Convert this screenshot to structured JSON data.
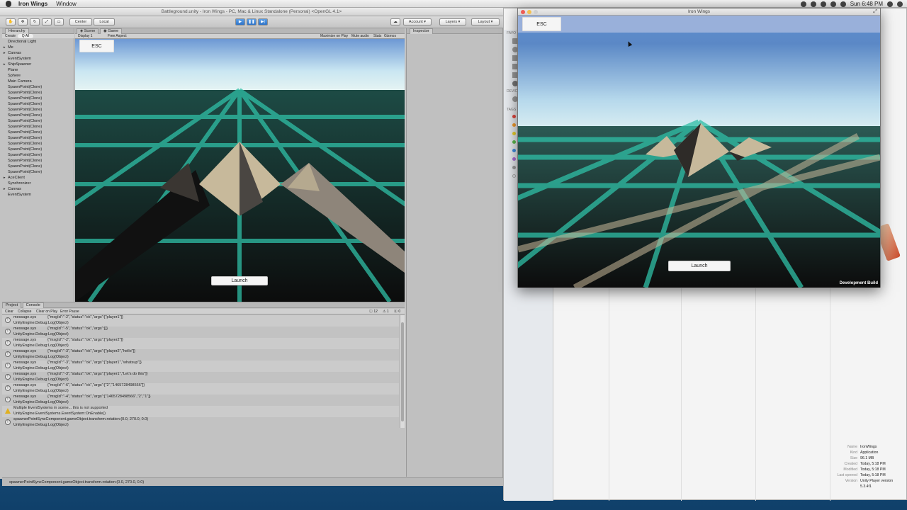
{
  "menubar": {
    "app_name": "Iron Wings",
    "menu_window": "Window",
    "clock": "Sun 6:48 PM"
  },
  "unity": {
    "title": "Battleground.unity - Iron Wings - PC, Mac & Linux Standalone (Personal) <OpenGL 4.1>",
    "toolbar": {
      "center": "Center",
      "local": "Local",
      "account": "Account",
      "layers": "Layers",
      "layout": "Layout"
    },
    "hierarchy": {
      "tab": "Hierarchy",
      "create": "Create",
      "search_placeholder": "Q All",
      "items": [
        "Directional Light",
        "Me",
        "Canvas",
        "EventSystem",
        "ShipSpawner",
        "Plane",
        "Sphere",
        "Main Camera",
        "SpawnPoint(Clone)",
        "SpawnPoint(Clone)",
        "SpawnPoint(Clone)",
        "SpawnPoint(Clone)",
        "SpawnPoint(Clone)",
        "SpawnPoint(Clone)",
        "SpawnPoint(Clone)",
        "SpawnPoint(Clone)",
        "SpawnPoint(Clone)",
        "SpawnPoint(Clone)",
        "SpawnPoint(Clone)",
        "SpawnPoint(Clone)",
        "SpawnPoint(Clone)",
        "SpawnPoint(Clone)",
        "SpawnPoint(Clone)",
        "SpawnPoint(Clone)",
        "AceClient",
        "Synchronizer",
        "Canvas",
        "EventSystem"
      ]
    },
    "game_panel": {
      "tab_scene": "Scene",
      "tab_game": "Game",
      "display": "Display 1",
      "aspect": "Free Aspect",
      "maximize": "Maximize on Play",
      "mute": "Mute audio",
      "stats": "Stats",
      "gizmos": "Gizmos",
      "esc_label": "ESC",
      "launch_label": "Launch"
    },
    "inspector": {
      "tab": "Inspector"
    },
    "console": {
      "tab_project": "Project",
      "tab_console": "Console",
      "clear": "Clear",
      "collapse": "Collapse",
      "clear_on_play": "Clear on Play",
      "error_pause": "Error Pause",
      "count_info": "12",
      "count_warn": "1",
      "count_err": "0",
      "rows": [
        {
          "type": "info",
          "line1_tag": "message.sys",
          "line1": "{\"msgId\":\"-2\",\"status\":\"ok\",\"args\":[\"player1\"]}",
          "line2": "UnityEngine.Debug:Log(Object)"
        },
        {
          "type": "info",
          "line1_tag": "message.sys",
          "line1": "{\"msgId\":\"-5\",\"status\":\"ok\",\"args\":[]}",
          "line2": "UnityEngine.Debug:Log(Object)"
        },
        {
          "type": "info",
          "line1_tag": "message.sys",
          "line1": "{\"msgId\":\"-2\",\"status\":\"ok\",\"args\":[\"player2\"]}",
          "line2": "UnityEngine.Debug:Log(Object)"
        },
        {
          "type": "info",
          "line1_tag": "message.sys",
          "line1": "{\"msgId\":\"-3\",\"status\":\"ok\",\"args\":[\"player2\",\"hello\"]}",
          "line2": "UnityEngine.Debug:Log(Object)"
        },
        {
          "type": "info",
          "line1_tag": "message.sys",
          "line1": "{\"msgId\":\"-3\",\"status\":\"ok\",\"args\":[\"player1\",\"whatsup\"]}",
          "line2": "UnityEngine.Debug:Log(Object)"
        },
        {
          "type": "info",
          "line1_tag": "message.sys",
          "line1": "{\"msgId\":\"-3\",\"status\":\"ok\",\"args\":[\"player1\",\"Let's do this\"]}",
          "line2": "UnityEngine.Debug:Log(Object)"
        },
        {
          "type": "info",
          "line1_tag": "message.sys",
          "line1": "{\"msgId\":\"-6\",\"status\":\"ok\",\"args\":[\"2\",\"1465728498566\"]}",
          "line2": "UnityEngine.Debug:Log(Object)"
        },
        {
          "type": "info",
          "line1_tag": "message.sys",
          "line1": "{\"msgId\":\"-4\",\"status\":\"ok\",\"args\":[\"1465728498566\",\"2\",\"1\"]}",
          "line2": "UnityEngine.Debug:Log(Object)"
        },
        {
          "type": "warn",
          "line1_tag": "",
          "line1": "Multiple EventSystems in scene... this is not supported",
          "line2": "UnityEngine.EventSystems.EventSystem:OnEnable()"
        },
        {
          "type": "info",
          "line1_tag": "",
          "line1": "spawnerPointSyncComponent.gameObject.transform.rotation:(0.0, 270.0, 0.0)",
          "line2": "UnityEngine.Debug:Log(Object)"
        }
      ]
    },
    "status_text": "spawnerPointSyncComponent.gameObject.transform.rotation:(0.0, 270.0, 0.0)"
  },
  "player": {
    "title": "Iron Wings",
    "esc_label": "ESC",
    "launch_label": "Launch",
    "dev_build": "Development Build"
  },
  "finder": {
    "sidebar_labels": [
      "FAVO",
      "DEVIC",
      "TAGS"
    ],
    "info": [
      {
        "k": "Name",
        "v": "IronWings"
      },
      {
        "k": "Kind",
        "v": "Application"
      },
      {
        "k": "Size",
        "v": "96.1 MB"
      },
      {
        "k": "Created",
        "v": "Today, 5:18 PM"
      },
      {
        "k": "Modified",
        "v": "Today, 5:18 PM"
      },
      {
        "k": "Last opened",
        "v": "Today, 5:18 PM"
      },
      {
        "k": "Version",
        "v": "Unity Player version"
      },
      {
        "k": "",
        "v": "5.3.4f1"
      }
    ]
  },
  "colors": {
    "grid_teal": "#2fbfa6",
    "grid_tan": "#c9b99a",
    "sky_top": "#5f8fcf",
    "play_blue": "#2e73c8"
  }
}
